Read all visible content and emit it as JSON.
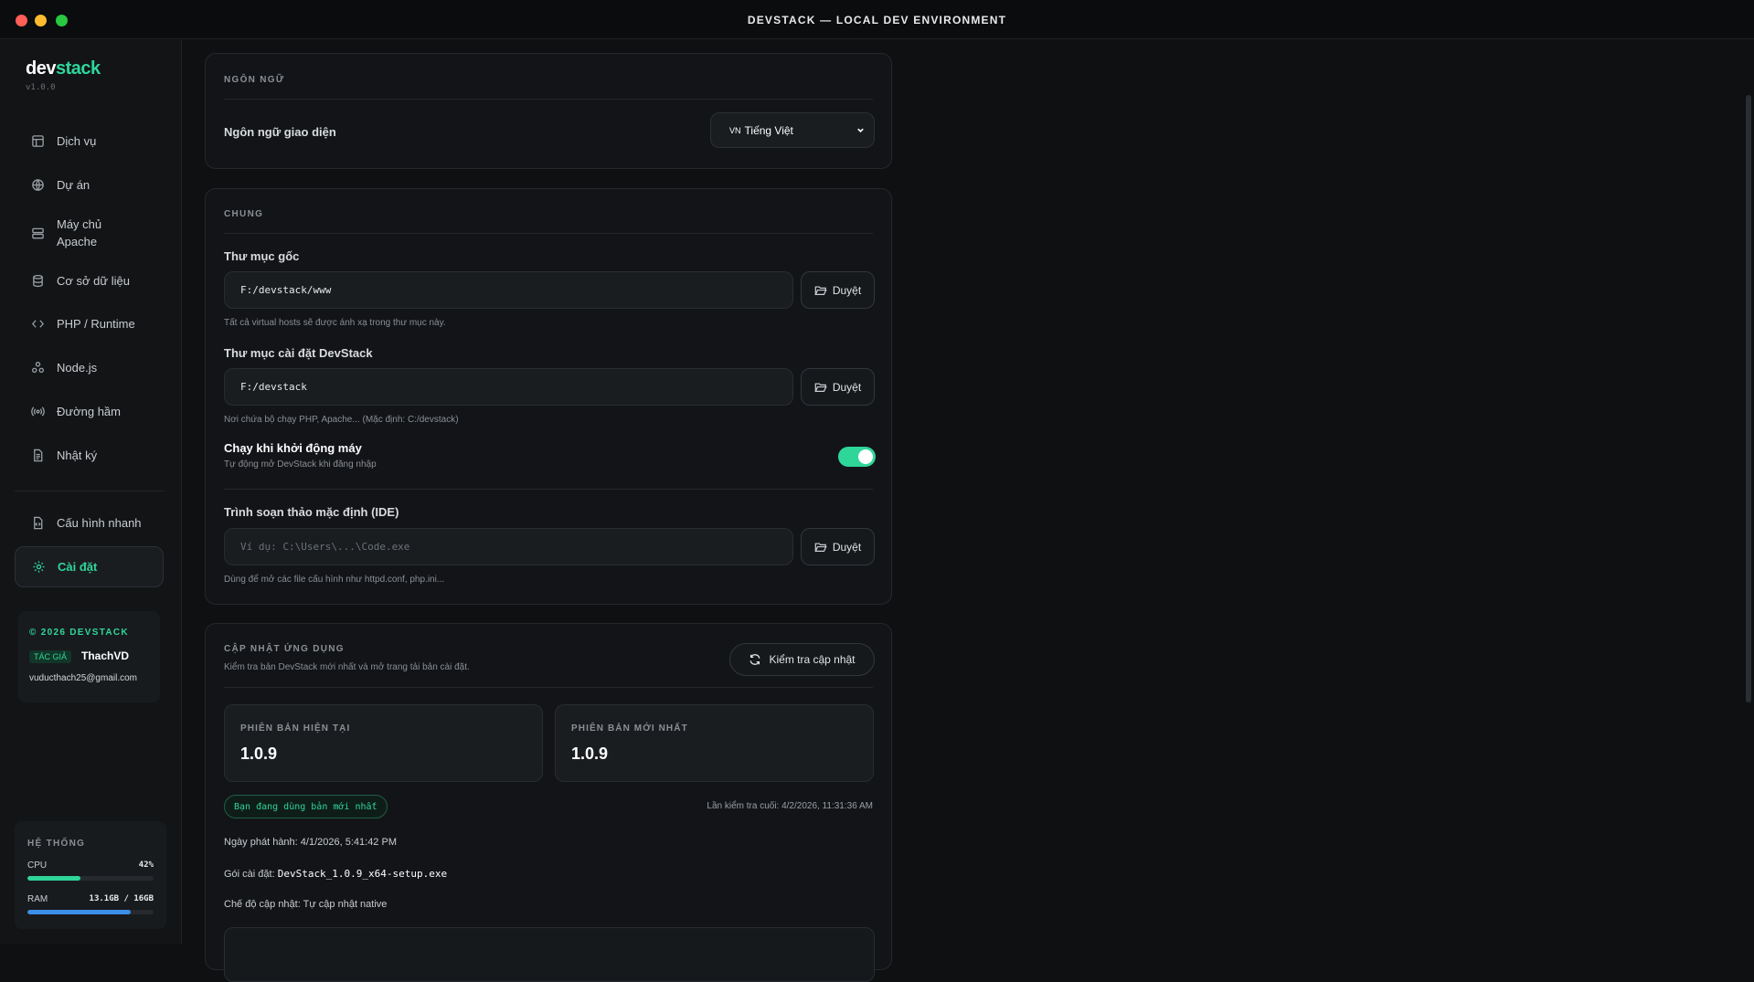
{
  "window": {
    "title": "DEVSTACK — LOCAL DEV ENVIRONMENT"
  },
  "brand": {
    "name_a": "dev",
    "name_b": "stack",
    "version": "v1.0.0",
    "accent": "#2fd69a"
  },
  "sidebar": {
    "items": [
      {
        "label": "Dịch vụ",
        "icon": "layout-icon"
      },
      {
        "label": "Dự án",
        "icon": "globe-icon"
      },
      {
        "label": "Máy chủ Apache",
        "icon": "server-icon"
      },
      {
        "label": "Cơ sở dữ liệu",
        "icon": "database-icon"
      },
      {
        "label": "PHP / Runtime",
        "icon": "code-icon"
      },
      {
        "label": "Node.js",
        "icon": "nodes-icon"
      },
      {
        "label": "Đường hầm",
        "icon": "radio-icon"
      },
      {
        "label": "Nhật ký",
        "icon": "file-text-icon"
      }
    ],
    "bottom_items": [
      {
        "label": "Cấu hình nhanh",
        "icon": "file-code-icon"
      },
      {
        "label": "Cài đặt",
        "icon": "gear-icon",
        "active": true
      }
    ],
    "credit": {
      "copyright": "© 2026 DEVSTACK",
      "badge": "TÁC GIẢ",
      "author": "ThachVD",
      "email": "vuducthach25@gmail.com"
    },
    "system": {
      "title": "HỆ THỐNG",
      "cpu_label": "CPU",
      "cpu_value": "42%",
      "cpu_fraction": 0.42,
      "cpu_color": "#2fd69a",
      "ram_label": "RAM",
      "ram_value": "13.1GB / 16GB",
      "ram_fraction": 0.82,
      "ram_color": "#3b8fe8"
    }
  },
  "language": {
    "section_title": "NGÔN NGỮ",
    "label": "Ngôn ngữ giao diện",
    "flag": "VN",
    "selected": "Tiếng Việt"
  },
  "general": {
    "section_title": "CHUNG",
    "root_label": "Thư mục gốc",
    "root_value": "F:/devstack/www",
    "root_hint": "Tất cả virtual hosts sẽ được ánh xạ trong thư mục này.",
    "install_label": "Thư mục cài đặt DevStack",
    "install_value": "F:/devstack",
    "install_hint": "Nơi chứa bộ chạy PHP, Apache... (Mặc định: C:/devstack)",
    "startup_label": "Chạy khi khởi động máy",
    "startup_hint": "Tự động mở DevStack khi đăng nhập",
    "startup_enabled": true,
    "ide_label": "Trình soạn thảo mặc định (IDE)",
    "ide_placeholder": "Ví dụ: C:\\Users\\...\\Code.exe",
    "ide_hint": "Dùng để mở các file cấu hình như httpd.conf, php.ini...",
    "browse_label": "Duyệt"
  },
  "update": {
    "section_title": "CẬP NHẬT ỨNG DỤNG",
    "subtitle": "Kiểm tra bản DevStack mới nhất và mở trang tải bản cài đặt.",
    "check_button": "Kiểm tra cập nhật",
    "current_label": "PHIÊN BẢN HIỆN TẠI",
    "current_value": "1.0.9",
    "latest_label": "PHIÊN BẢN MỚI NHẤT",
    "latest_value": "1.0.9",
    "status_pill": "Bạn đang dùng bản mới nhất",
    "last_check": "Lần kiểm tra cuối: 4/2/2026, 11:31:36 AM",
    "release_prefix": "Ngày phát hành: ",
    "release_value": "4/1/2026, 5:41:42 PM",
    "package_prefix": "Gói cài đặt: ",
    "package_value": "DevStack_1.0.9_x64-setup.exe",
    "mode_prefix": "Chế độ cập nhật: ",
    "mode_value": "Tự cập nhật native"
  }
}
